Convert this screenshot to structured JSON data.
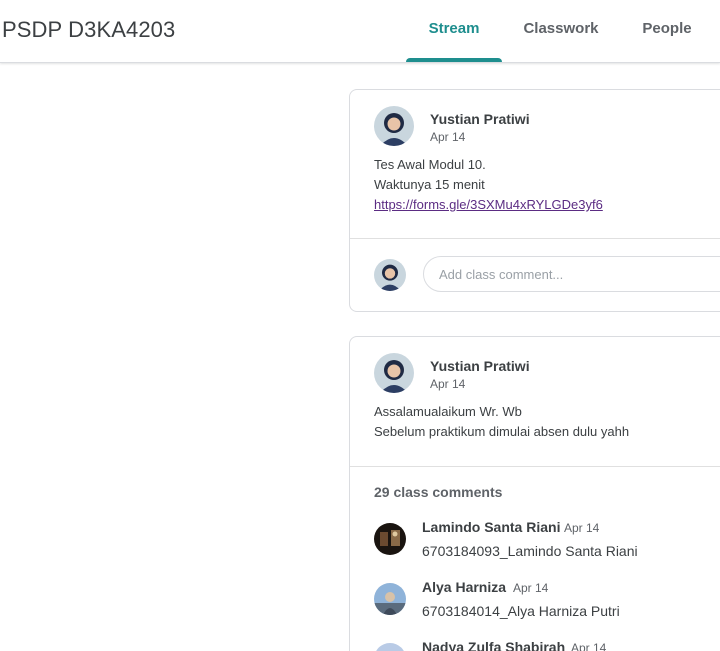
{
  "header": {
    "class_title": "PSDP D3KA4203",
    "tabs": [
      {
        "label": "Stream",
        "active": true
      },
      {
        "label": "Classwork",
        "active": false
      },
      {
        "label": "People",
        "active": false
      }
    ],
    "accent_color": "#1e8e8e"
  },
  "posts": [
    {
      "author": "Yustian Pratiwi",
      "date": "Apr 14",
      "body_lines": [
        "Tes Awal Modul 10.",
        "Waktunya 15 menit"
      ],
      "link": "https://forms.gle/3SXMu4xRYLGDe3yf6",
      "comment_placeholder": "Add class comment..."
    },
    {
      "author": "Yustian Pratiwi",
      "date": "Apr 14",
      "body_lines": [
        "Assalamualaikum Wr. Wb",
        "Sebelum praktikum dimulai absen dulu yahh"
      ],
      "comments_count_label": "29 class comments",
      "comments": [
        {
          "name": "Lamindo Santa Riani",
          "date": "Apr 14",
          "text": "6703184093_Lamindo Santa Riani"
        },
        {
          "name": "Alya Harniza",
          "date": "Apr 14",
          "text": "6703184014_Alya Harniza Putri"
        },
        {
          "name": "Nadya Zulfa Shabirah",
          "date": "Apr 14",
          "text": ""
        }
      ]
    }
  ]
}
